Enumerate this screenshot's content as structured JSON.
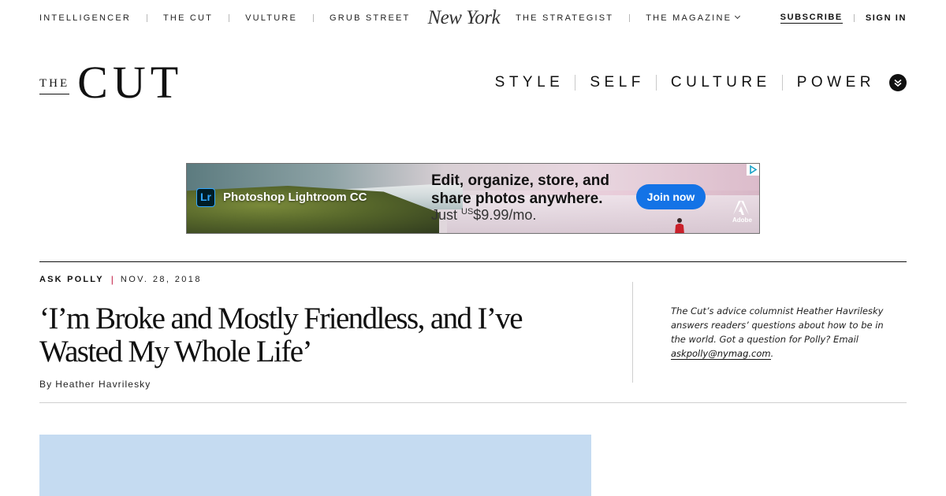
{
  "network_bar": {
    "links_left": [
      "INTELLIGENCER",
      "THE CUT",
      "VULTURE",
      "GRUB STREET"
    ],
    "logo": "New York",
    "links_right": [
      "THE STRATEGIST",
      "THE MAGAZINE"
    ],
    "subscribe": "SUBSCRIBE",
    "sign_in": "SIGN IN"
  },
  "site_header": {
    "logo_the": "THE",
    "logo_cut": "CUT",
    "nav": [
      "STYLE",
      "SELF",
      "CULTURE",
      "POWER"
    ]
  },
  "ad": {
    "product_badge": "Lr",
    "product_name": "Photoshop Lightroom CC",
    "headline_line1": "Edit, organize, store, and",
    "headline_line2": "share photos anywhere.",
    "price_prefix": "Just ",
    "price_currency": "US",
    "price_amount": "$9.99/mo.",
    "cta": "Join now",
    "brand": "Adobe",
    "colors": {
      "cta": "#1473e6",
      "badge_border": "#31a8ff",
      "badge_bg": "#001d26"
    }
  },
  "article": {
    "rubric": "ASK POLLY",
    "date": "NOV. 28, 2018",
    "headline": "‘I’m Broke and Mostly Friendless, and I’ve Wasted My Whole Life’",
    "byline_prefix": "By",
    "author": "Heather Havrilesky",
    "series_description_prefix": "The Cut’s advice columnist Heather Havrilesky answers readers’ questions about how to be in the world. Got a question for Polly? Email ",
    "series_email": "askpolly@nymag.com",
    "series_description_suffix": ".",
    "colors": {
      "rubric_separator": "#c0123c",
      "lead_image": "#c5dbf1"
    }
  }
}
